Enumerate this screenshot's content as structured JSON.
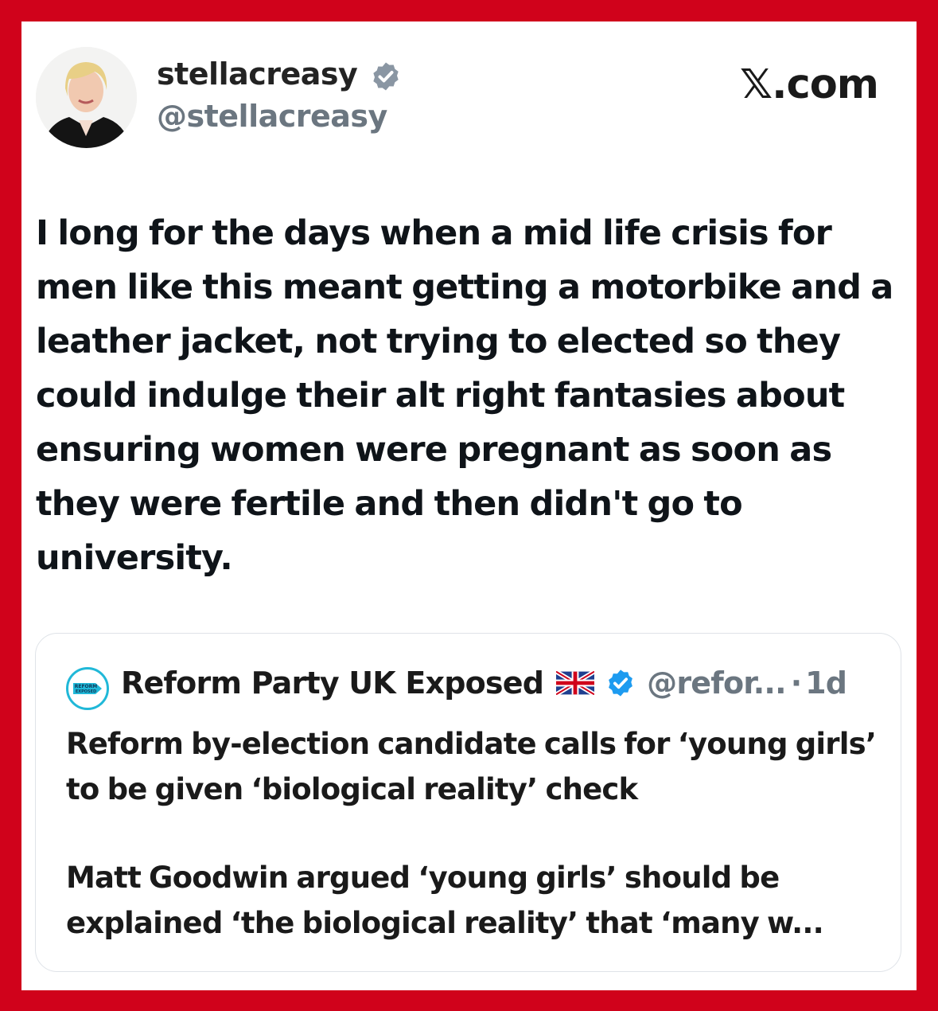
{
  "tweet": {
    "display_name": "stellacreasy",
    "handle": "@stellacreasy",
    "site": "𝕏.com",
    "avatar_icon": "profile-photo",
    "verified_icon": "verified-badge-gray",
    "text": "I long for the days when a mid life crisis for men like this meant getting a motorbike and a leather jacket, not trying to elected so they could indulge their alt right fantasies about ensuring women were pregnant as soon as they were fertile and then didn't go to university."
  },
  "quoted": {
    "logo_icon": "reform-exposed-logo",
    "logo_text": "REFORM EXPOSED",
    "name": "Reform Party UK Exposed",
    "flag_icon": "uk-flag-icon",
    "verified_icon": "verified-badge-blue",
    "handle": "@refor...",
    "separator": "·",
    "time": "1d",
    "headline": "Reform by-election candidate calls for ‘young girls’ to be given ‘biological reality’ check",
    "snippet": "Matt Goodwin argued ‘young girls’ should be explained ‘the biological reality’ that ‘many w..."
  },
  "colors": {
    "frame": "#d0021b",
    "card": "#ffffff",
    "verified_blue": "#1d9bf0",
    "verified_gray": "#8a96a3",
    "muted_text": "#6b7680"
  }
}
